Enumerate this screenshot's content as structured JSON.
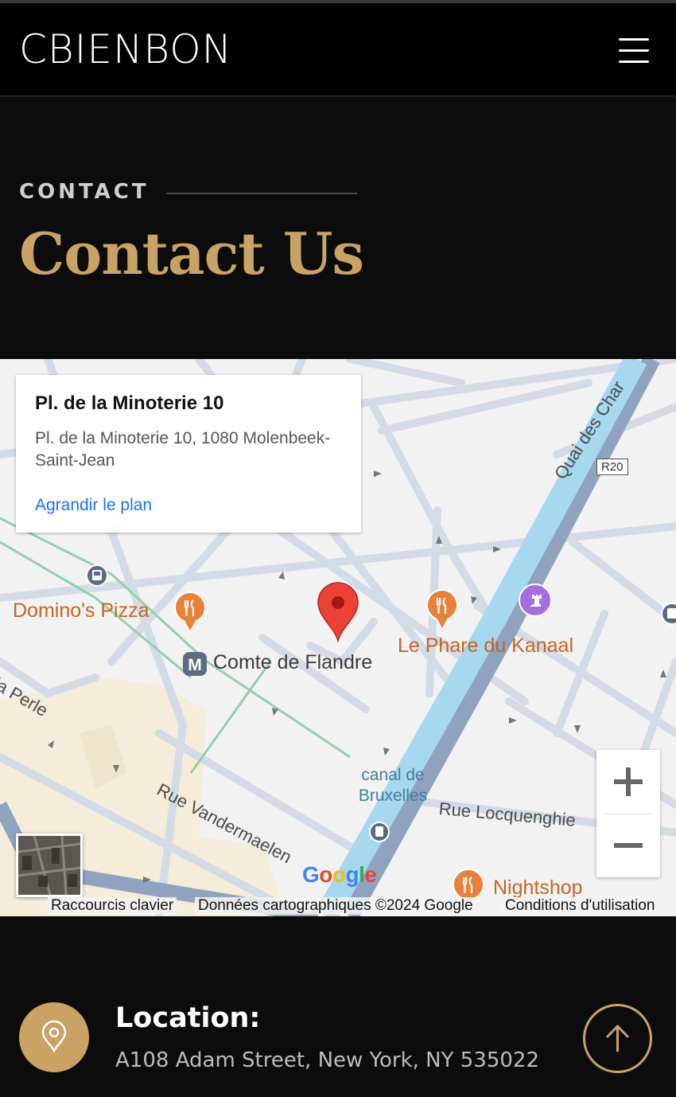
{
  "header": {
    "brand": "CBIENBON",
    "menu_icon": "hamburger-icon"
  },
  "hero": {
    "eyebrow": "CONTACT",
    "title": "Contact Us"
  },
  "map": {
    "info_card": {
      "title": "Pl. de la Minoterie 10",
      "address": "Pl. de la Minoterie 10, 1080 Molenbeek-Saint-Jean",
      "link": "Agrandir le plan"
    },
    "labels": {
      "dominos": "Domino's Pizza",
      "phare": "Le Phare du Kanaal",
      "metro": "Comte de Flandre",
      "vandermaelen": "Rue Vandermaelen",
      "locquenghien": "Rue Locquenghie",
      "canal": "canal de\nBruxelles",
      "nightshop": "Nightshop",
      "quai": "Quai des Char",
      "perle": "la Perle",
      "road_shield": "R20"
    },
    "zoom_in_icon": "plus-icon",
    "zoom_out_icon": "minus-icon",
    "attribution": {
      "shortcuts": "Raccourcis clavier",
      "data": "Données cartographiques ©2024 Google",
      "terms": "Conditions d'utilisation"
    },
    "google_logo": "Google",
    "colors": {
      "canal": "#a6d8ee",
      "road": "#d3dbe6",
      "poi": "#e8813a",
      "pin": "#ea4335"
    }
  },
  "contact": {
    "location_title": "Location:",
    "location_text": "A108 Adam Street, New York, NY 535022",
    "location_icon": "map-pin-icon",
    "back_to_top_icon": "arrow-up-icon"
  },
  "colors": {
    "accent": "#c9a264",
    "background": "#0c0c0c"
  }
}
